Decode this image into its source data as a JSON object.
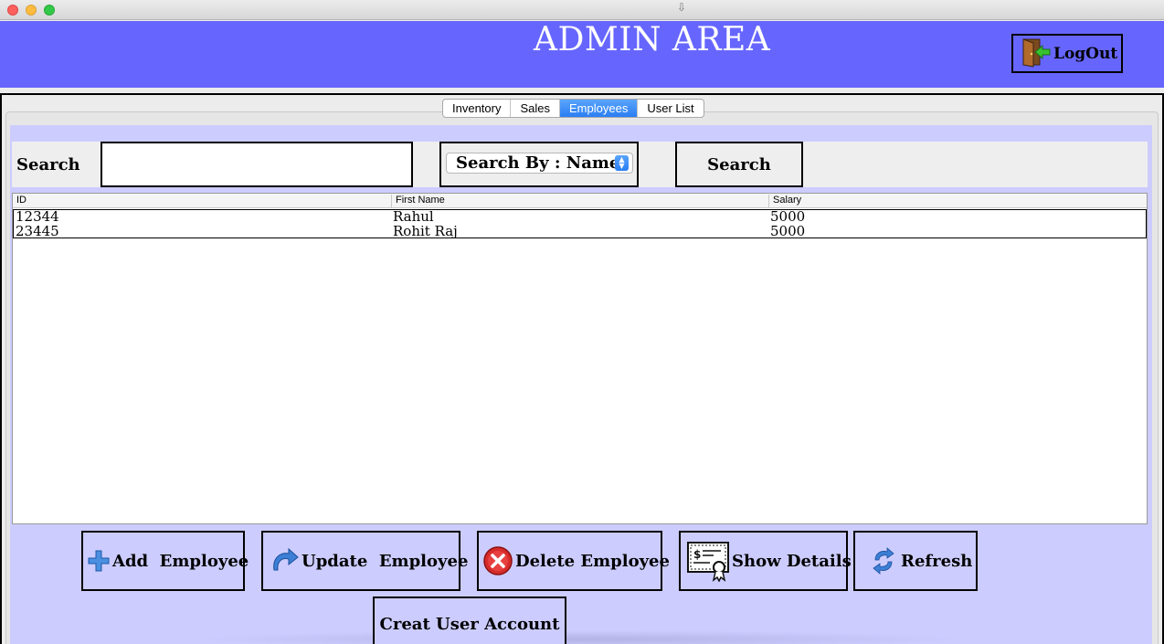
{
  "window": {
    "title_icon": "download-arrow-icon",
    "title_glyph": "⇩"
  },
  "header": {
    "title": "ADMIN AREA",
    "logout_label": "LogOut",
    "logout_icon": "exit-door-icon"
  },
  "colors": {
    "header_bg": "#6666ff",
    "panel_bg": "#ccccff",
    "tab_active": "#2a7ef3"
  },
  "tabs": [
    {
      "label": "Inventory",
      "active": false
    },
    {
      "label": "Sales",
      "active": false
    },
    {
      "label": "Employees",
      "active": true
    },
    {
      "label": "User List",
      "active": false
    }
  ],
  "search": {
    "label": "Search",
    "input_value": "",
    "search_by_selected": "Search By : Name",
    "button_label": "Search"
  },
  "table": {
    "columns": [
      "ID",
      "First Name",
      "Salary"
    ],
    "rows": [
      [
        "12344",
        "Rahul",
        "5000"
      ],
      [
        "23445",
        "Rohit Raj",
        "5000"
      ]
    ]
  },
  "actions": {
    "add": {
      "label": "Add  Employee",
      "icon": "plus-icon"
    },
    "update": {
      "label": "Update  Employee",
      "icon": "redo-arrow-icon"
    },
    "delete": {
      "label": "Delete Employee",
      "icon": "delete-x-icon"
    },
    "details": {
      "label": "Show Details",
      "icon": "certificate-icon"
    },
    "refresh": {
      "label": "Refresh",
      "icon": "refresh-icon"
    },
    "create_account": {
      "label": "Creat User Account"
    }
  }
}
